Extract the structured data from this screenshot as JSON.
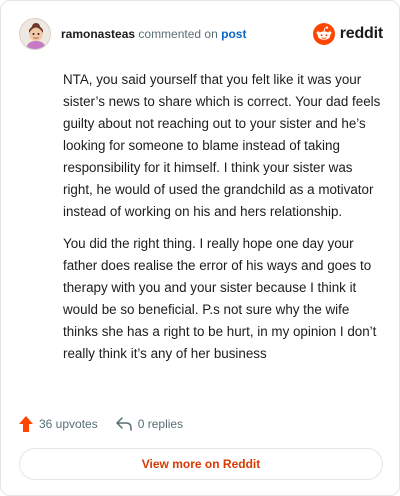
{
  "header": {
    "username": "ramonasteas",
    "action_text": "commented on",
    "post_link": "post",
    "brand": "reddit"
  },
  "comment": {
    "paragraphs": [
      "NTA, you said yourself that you felt like it was your sister’s news to share which is correct. Your dad feels guilty about not reaching out to your sister and he’s looking for someone to blame instead of taking responsibility for it himself. I think your sister was right, he would of used the grandchild as a motivator instead of working on his and hers relationship.",
      "You did the right thing. I really hope one day your father does realise the error of his ways and goes to therapy with you and your sister because I think it would be so beneficial. P.s not sure why the wife thinks she has a right to be hurt, in my opinion I don’t really think it’s any of her business"
    ]
  },
  "actions": {
    "upvotes": "36 upvotes",
    "replies": "0 replies"
  },
  "footer": {
    "view_more": "View more on Reddit"
  },
  "colors": {
    "reddit_orange": "#ff4500",
    "link_blue": "#0a66c2",
    "view_more_text": "#d93900"
  },
  "icons": [
    "avatar",
    "reddit-logo-icon",
    "upvote-arrow-icon",
    "reply-icon"
  ]
}
